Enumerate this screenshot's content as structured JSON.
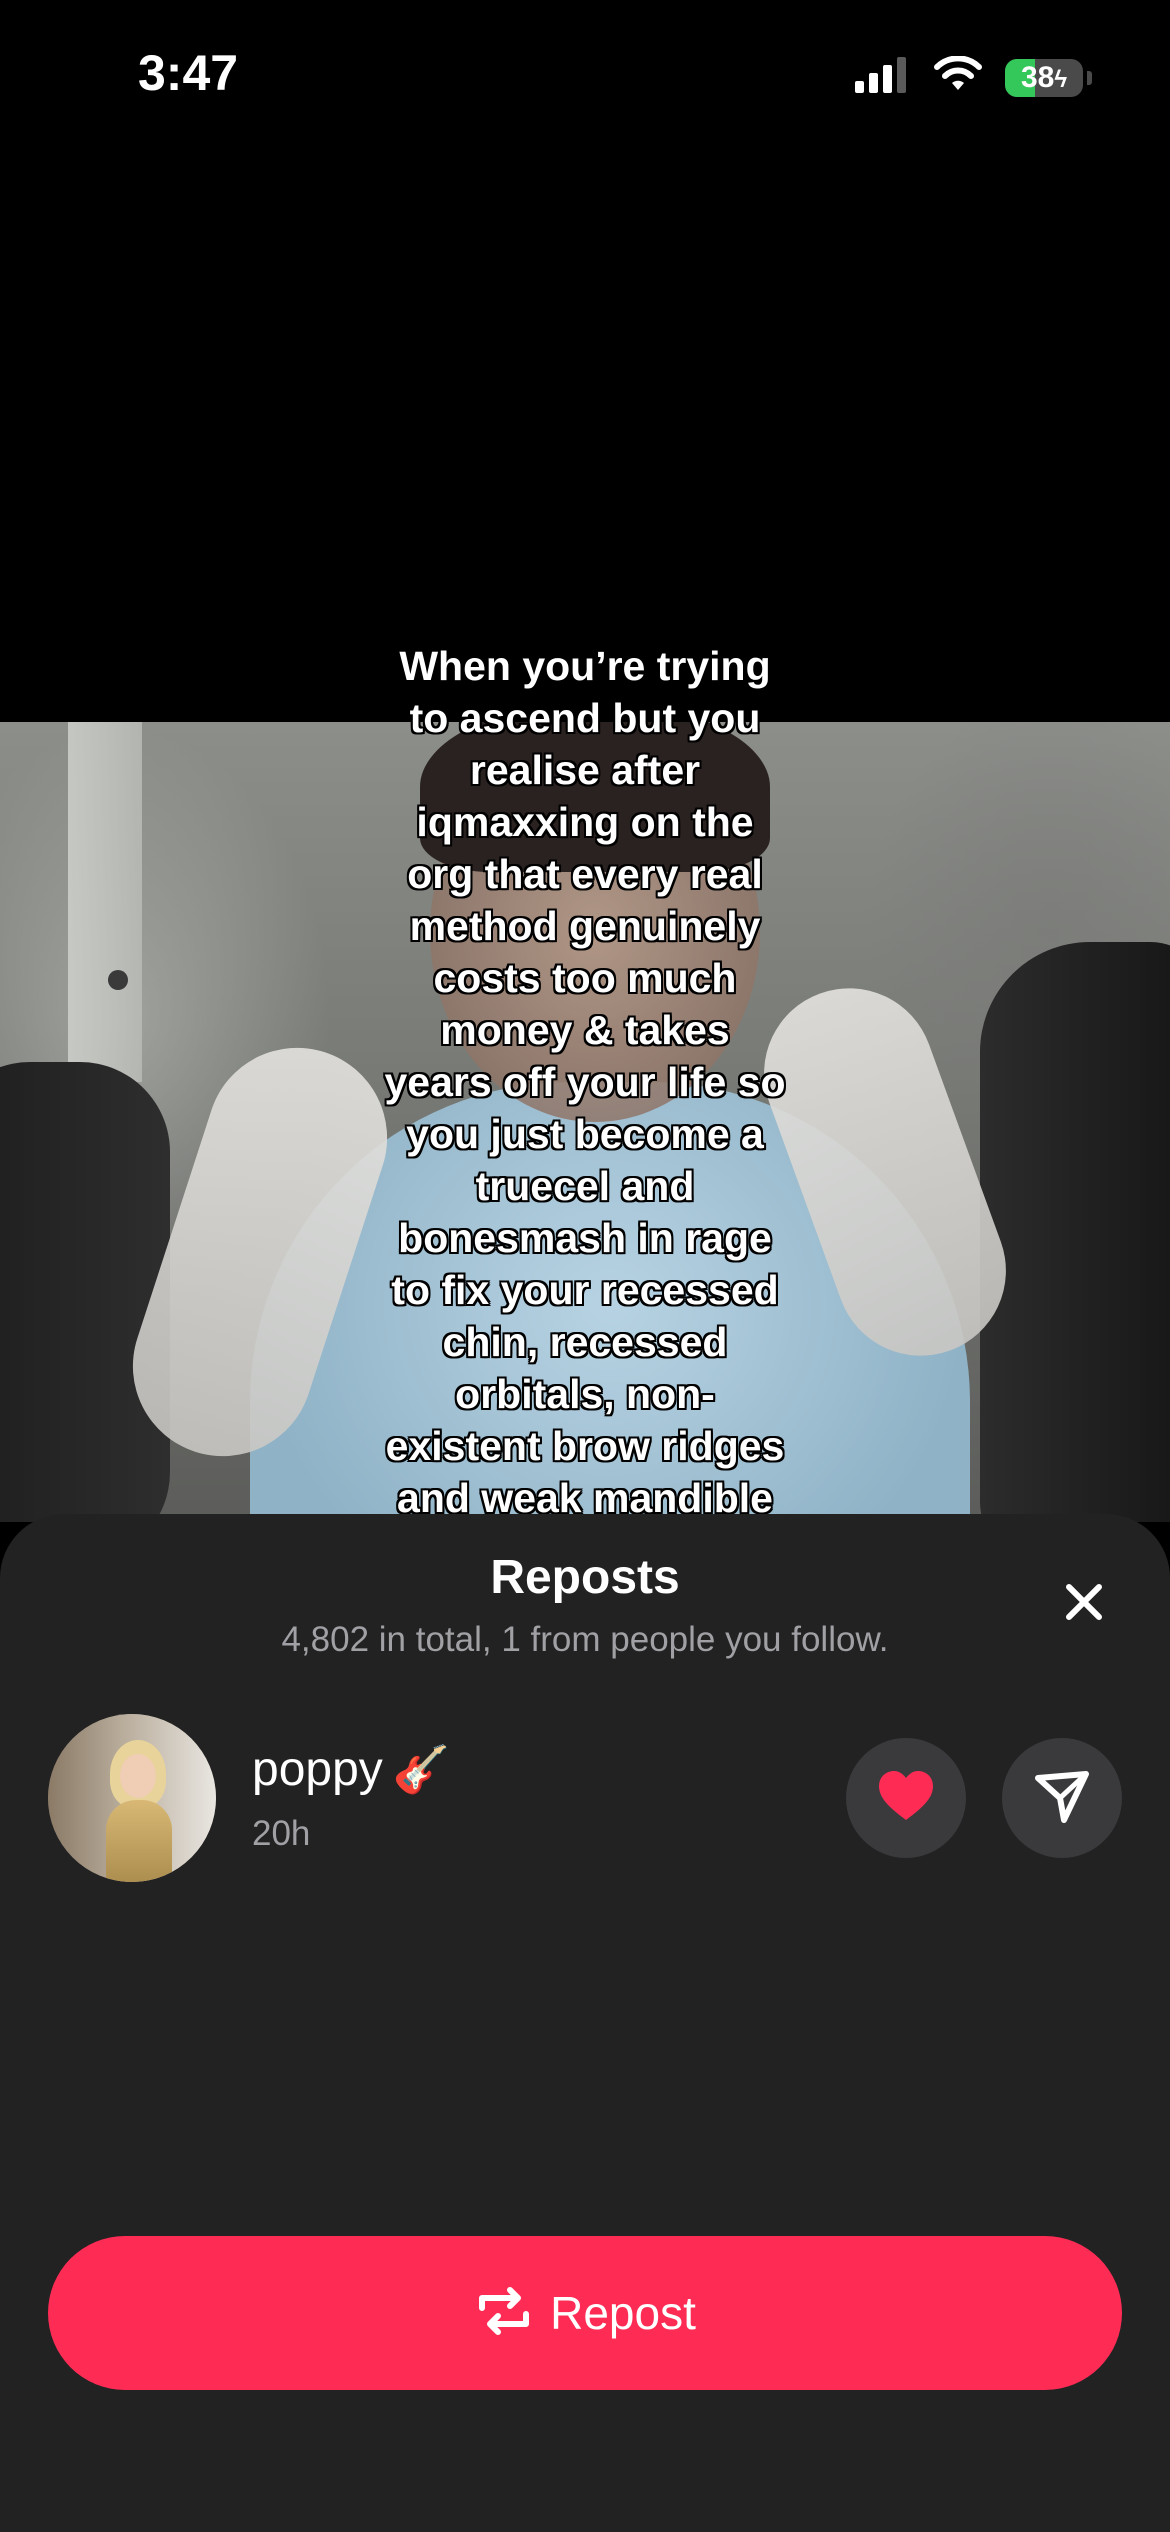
{
  "status_bar": {
    "time": "3:47",
    "battery_percent": "38",
    "battery_level": 0.38,
    "signal_icon": "cellular-signal-icon",
    "wifi_icon": "wifi-icon",
    "charging_icon": "bolt-icon"
  },
  "video": {
    "caption": "When you’re trying\nto ascend but you\nrealise after\niqmaxxing on the\norg that every real\nmethod genuinely\ncosts too much\nmoney & takes\nyears off your life so\nyou just become a\ntruecel and\nbonesmash in rage\nto fix your recessed\nchin, recessed\norbitals, non-\nexistent brow ridges\nand weak mandible"
  },
  "sheet": {
    "title": "Reposts",
    "subtitle": "4,802 in total, 1 from people you follow.",
    "close_icon": "close-icon"
  },
  "reposts": [
    {
      "username": "poppy",
      "emoji": "🎸",
      "time": "20h",
      "like_icon": "heart-icon",
      "share_icon": "send-icon"
    }
  ],
  "repost_button": {
    "label": "Repost",
    "icon": "repost-icon"
  },
  "colors": {
    "accent": "#fe2c55",
    "sheet_bg": "#222223",
    "heart": "#fe2c55",
    "battery_green": "#34c759"
  }
}
